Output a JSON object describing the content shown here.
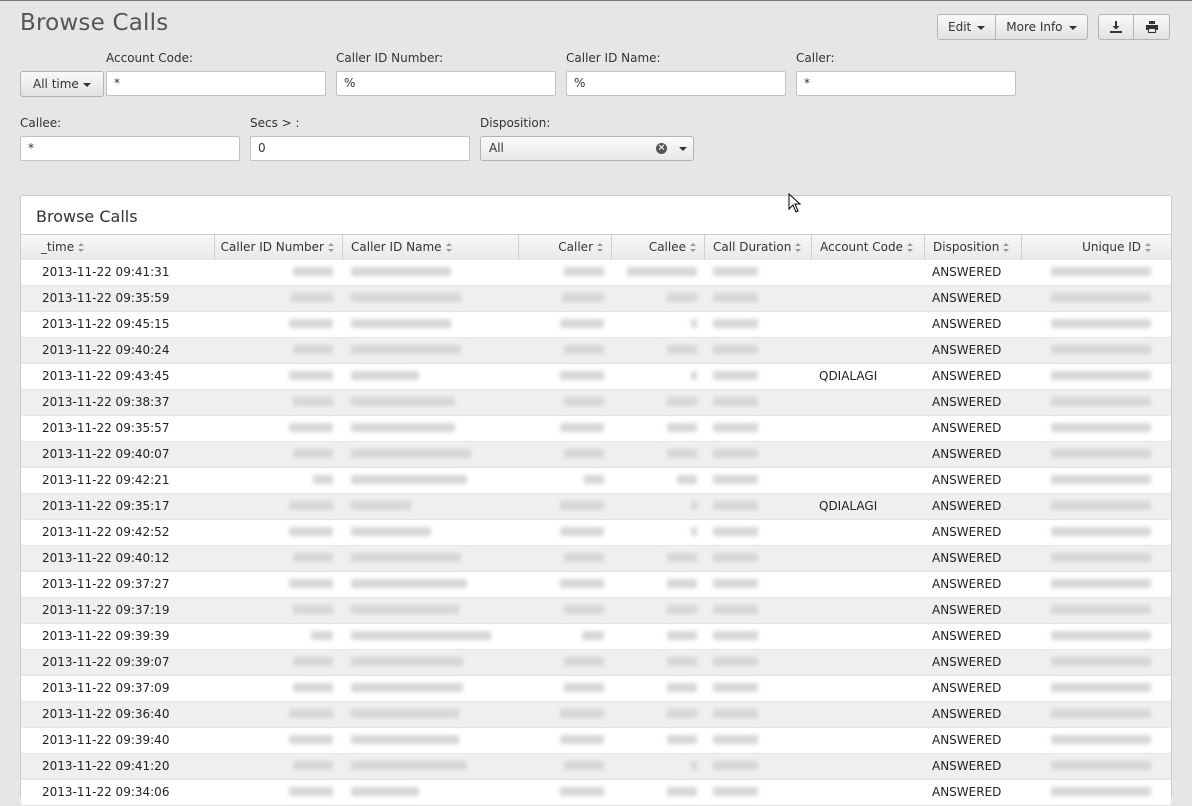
{
  "page": {
    "title": "Browse Calls",
    "edit_label": "Edit",
    "more_info_label": "More Info",
    "export_icon": "download-icon",
    "print_icon": "print-icon"
  },
  "filters": {
    "time_range": "All time",
    "account_code": {
      "label": "Account Code:",
      "value": "*"
    },
    "caller_id_number": {
      "label": "Caller ID Number:",
      "value": "%"
    },
    "caller_id_name": {
      "label": "Caller ID Name:",
      "value": "%"
    },
    "caller": {
      "label": "Caller:",
      "value": "*"
    },
    "callee": {
      "label": "Callee:",
      "value": "*"
    },
    "secs": {
      "label": "Secs > :",
      "value": "0"
    },
    "disposition": {
      "label": "Disposition:",
      "value": "All"
    }
  },
  "table": {
    "title": "Browse Calls",
    "columns": [
      "_time",
      "Caller ID Number",
      "Caller ID Name",
      "Caller",
      "Callee",
      "Call Duration",
      "Account Code",
      "Disposition",
      "Unique ID"
    ],
    "rows": [
      {
        "time": "2013-11-22 09:41:31",
        "account_code": "",
        "disposition": "ANSWERED"
      },
      {
        "time": "2013-11-22 09:35:59",
        "account_code": "",
        "disposition": "ANSWERED"
      },
      {
        "time": "2013-11-22 09:45:15",
        "account_code": "",
        "disposition": "ANSWERED"
      },
      {
        "time": "2013-11-22 09:40:24",
        "account_code": "",
        "disposition": "ANSWERED"
      },
      {
        "time": "2013-11-22 09:43:45",
        "account_code": "QDIALAGI",
        "disposition": "ANSWERED"
      },
      {
        "time": "2013-11-22 09:38:37",
        "account_code": "",
        "disposition": "ANSWERED"
      },
      {
        "time": "2013-11-22 09:35:57",
        "account_code": "",
        "disposition": "ANSWERED"
      },
      {
        "time": "2013-11-22 09:40:07",
        "account_code": "",
        "disposition": "ANSWERED"
      },
      {
        "time": "2013-11-22 09:42:21",
        "account_code": "",
        "disposition": "ANSWERED"
      },
      {
        "time": "2013-11-22 09:35:17",
        "account_code": "QDIALAGI",
        "disposition": "ANSWERED"
      },
      {
        "time": "2013-11-22 09:42:52",
        "account_code": "",
        "disposition": "ANSWERED"
      },
      {
        "time": "2013-11-22 09:40:12",
        "account_code": "",
        "disposition": "ANSWERED"
      },
      {
        "time": "2013-11-22 09:37:27",
        "account_code": "",
        "disposition": "ANSWERED"
      },
      {
        "time": "2013-11-22 09:37:19",
        "account_code": "",
        "disposition": "ANSWERED"
      },
      {
        "time": "2013-11-22 09:39:39",
        "account_code": "",
        "disposition": "ANSWERED"
      },
      {
        "time": "2013-11-22 09:39:07",
        "account_code": "",
        "disposition": "ANSWERED"
      },
      {
        "time": "2013-11-22 09:37:09",
        "account_code": "",
        "disposition": "ANSWERED"
      },
      {
        "time": "2013-11-22 09:36:40",
        "account_code": "",
        "disposition": "ANSWERED"
      },
      {
        "time": "2013-11-22 09:39:40",
        "account_code": "",
        "disposition": "ANSWERED"
      },
      {
        "time": "2013-11-22 09:41:20",
        "account_code": "",
        "disposition": "ANSWERED"
      },
      {
        "time": "2013-11-22 09:34:06",
        "account_code": "",
        "disposition": "ANSWERED"
      }
    ]
  }
}
